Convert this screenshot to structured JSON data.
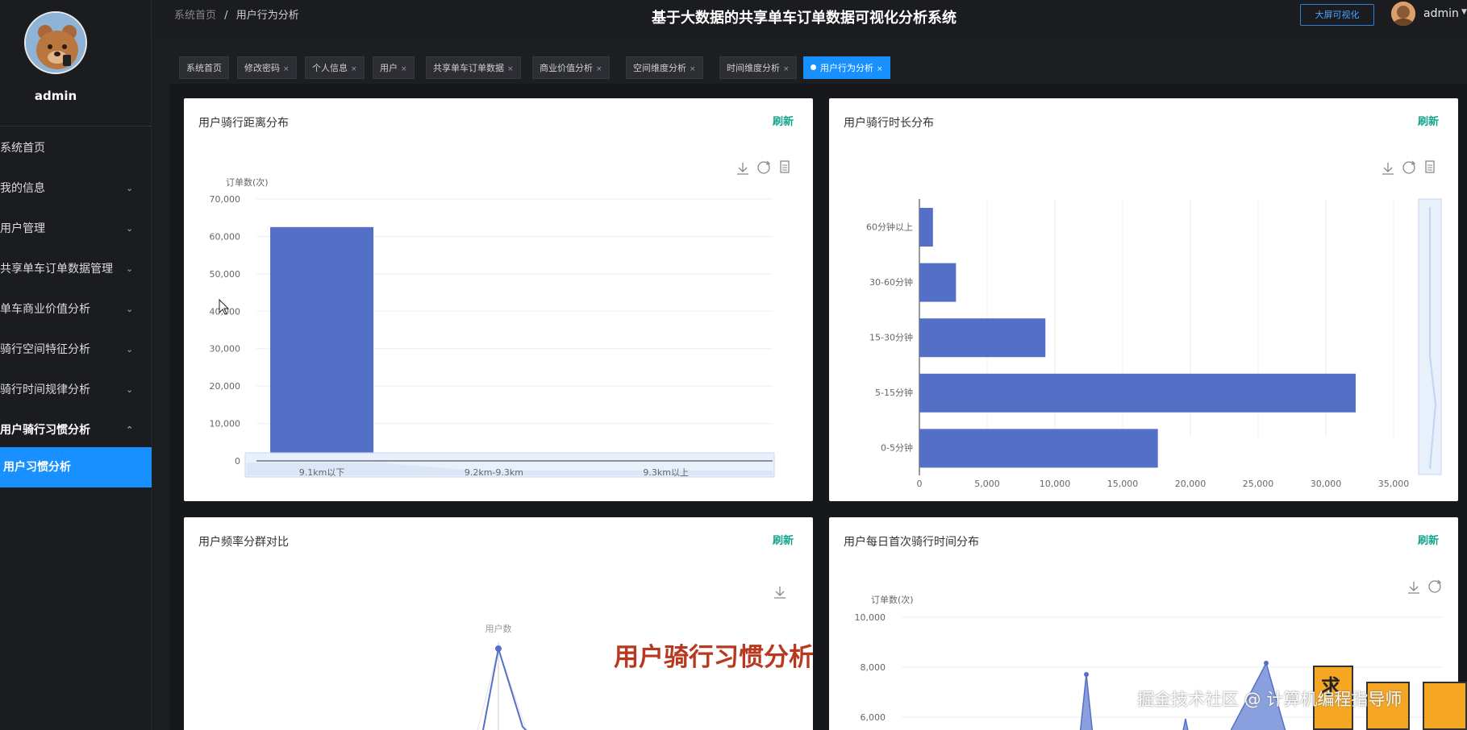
{
  "header": {
    "breadcrumb_root": "系统首页",
    "breadcrumb_sep": "/",
    "breadcrumb_current": "用户行为分析",
    "title": "基于大数据的共享单车订单数据可视化分析系统",
    "bigscreen_label": "大屏可视化",
    "user_name": "admin"
  },
  "sidebar": {
    "user_name": "admin",
    "items": [
      {
        "label": "系统首页",
        "chevron": false
      },
      {
        "label": "我的信息",
        "chevron": true
      },
      {
        "label": "用户管理",
        "chevron": true
      },
      {
        "label": "共享单车订单数据管理",
        "chevron": true
      },
      {
        "label": "单车商业价值分析",
        "chevron": true
      },
      {
        "label": "骑行空间特征分析",
        "chevron": true
      },
      {
        "label": "骑行时间规律分析",
        "chevron": true
      },
      {
        "label": "用户骑行习惯分析",
        "chevron": true,
        "expanded": true
      },
      {
        "label": "用户习惯分析",
        "active": true
      }
    ]
  },
  "tabs": [
    {
      "label": "系统首页",
      "closable": false
    },
    {
      "label": "修改密码",
      "closable": true
    },
    {
      "label": "个人信息",
      "closable": true
    },
    {
      "label": "用户",
      "closable": true
    },
    {
      "label": "共享单车订单数据",
      "closable": true
    },
    {
      "label": "商业价值分析",
      "closable": true
    },
    {
      "label": "空间维度分析",
      "closable": true
    },
    {
      "label": "时间维度分析",
      "closable": true
    },
    {
      "label": "用户行为分析",
      "closable": true,
      "active": true
    }
  ],
  "close_glyph": "×",
  "refresh_label": "刷新",
  "cards": {
    "distance": {
      "title": "用户骑行距离分布"
    },
    "duration": {
      "title": "用户骑行时长分布"
    },
    "frequency": {
      "title": "用户频率分群对比"
    },
    "first_ride": {
      "title": "用户每日首次骑行时间分布"
    }
  },
  "chart_data": [
    {
      "type": "bar",
      "categories": [
        "9.1km以下",
        "9.2km-9.3km",
        "9.3km以上"
      ],
      "values": [
        62500,
        120,
        40
      ],
      "ylabel": "订单数(次)",
      "ylim": [
        0,
        70000
      ],
      "yticks": [
        0,
        10000,
        20000,
        30000,
        40000,
        50000,
        60000,
        70000
      ],
      "ytick_labels": [
        "0",
        "10,000",
        "20,000",
        "30,000",
        "40,000",
        "50,000",
        "60,000",
        "70,000"
      ],
      "grid": true,
      "data_zoom": true
    },
    {
      "type": "bar",
      "orientation": "horizontal",
      "categories": [
        "0-5分钟",
        "5-15分钟",
        "15-30分钟",
        "30-60分钟",
        "60分钟以上"
      ],
      "values": [
        17600,
        32200,
        9300,
        2700,
        1000
      ],
      "xlim": [
        0,
        35000
      ],
      "xticks": [
        0,
        5000,
        10000,
        15000,
        20000,
        25000,
        30000,
        35000
      ],
      "xtick_labels": [
        "0",
        "5,000",
        "10,000",
        "15,000",
        "20,000",
        "25,000",
        "30,000",
        "35,000"
      ],
      "grid": true,
      "data_zoom": true
    },
    {
      "type": "radar",
      "series": [
        {
          "name": "用户数"
        }
      ],
      "grid": false
    },
    {
      "type": "area",
      "ylabel": "订单数(次)",
      "ylim": [
        6000,
        10000
      ],
      "yticks": [
        6000,
        8000,
        10000
      ],
      "ytick_labels": [
        "6,000",
        "8,000",
        "10,000"
      ],
      "grid": true
    }
  ],
  "overlay": {
    "caption": "用户骑行习惯分析",
    "watermark": "掘金技术社区 @ 计算机编程指导师",
    "sticker_char": "求"
  },
  "colors": {
    "bar": "#5470c6",
    "accent": "#1890ff",
    "refresh": "#13a58c",
    "caption": "#b8391f"
  }
}
